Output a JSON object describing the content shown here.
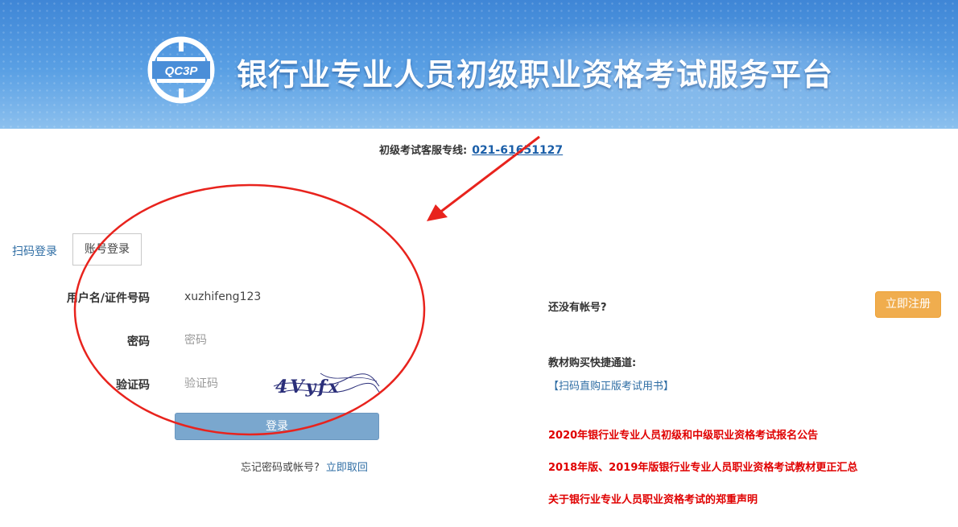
{
  "header": {
    "logo_text": "QC3P",
    "title": "银行业专业人员初级职业资格考试服务平台"
  },
  "hotline": {
    "label": "初级考试客服专线:",
    "phone": "021-61651127"
  },
  "tabs": {
    "qr": "扫码登录",
    "account": "账号登录"
  },
  "form": {
    "username_label": "用户名/证件号码",
    "username_value": "xuzhifeng123",
    "password_label": "密码",
    "password_placeholder": "密码",
    "captcha_label": "验证码",
    "captcha_placeholder": "验证码",
    "captcha_text": "4Vyfx",
    "login_button": "登录",
    "forgot_text": "忘记密码或帐号?",
    "forgot_link": "立即取回"
  },
  "right_panel": {
    "no_account": "还没有帐号?",
    "register_button": "立即注册",
    "books_title": "教材购买快捷通道:",
    "books_link": "【扫码直购正版考试用书】",
    "notices": [
      "2020年银行业专业人员初级和中级职业资格考试报名公告",
      "2018年版、2019年版银行业专业人员职业资格考试教材更正汇总",
      "关于银行业专业人员职业资格考试的郑重声明"
    ]
  },
  "colors": {
    "banner": "#4a90dc",
    "link": "#2e6da4",
    "login_button": "#7aa7ce",
    "register_button": "#f0ad4e",
    "notice": "#e00000",
    "annotation": "#e8231d"
  }
}
